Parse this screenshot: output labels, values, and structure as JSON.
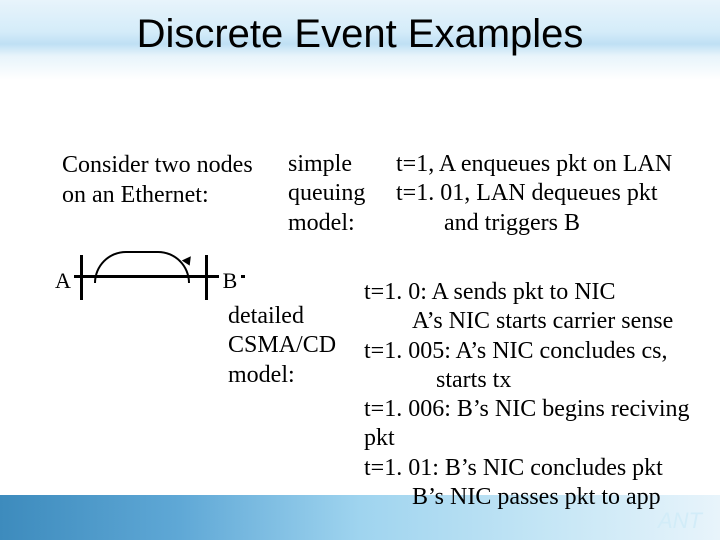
{
  "title": "Discrete Event Examples",
  "subtitle1_l1": "Consider two nodes",
  "subtitle1_l2": "on an Ethernet:",
  "sqm_l1": "simple",
  "sqm_l2": "queuing",
  "sqm_l3": "model:",
  "sq_line1": "t=1, A enqueues pkt on LAN",
  "sq_line2": "t=1. 01, LAN dequeues pkt",
  "sq_line3": "        and triggers B",
  "det_l1": "detailed",
  "det_l2": "CSMA/CD",
  "det_l3": "model:",
  "d1": "t=1. 0: A sends pkt to NIC",
  "d2": "        A’s NIC starts carrier sense",
  "d3": "t=1. 005: A’s NIC concludes cs,",
  "d4": "            starts tx",
  "d5": "t=1. 006: B’s NIC begins reciving pkt",
  "d6": "t=1. 01: B’s NIC concludes pkt",
  "d7": "        B’s NIC passes pkt to app",
  "nodeA": "A",
  "nodeB": "B",
  "logo": "ANT"
}
